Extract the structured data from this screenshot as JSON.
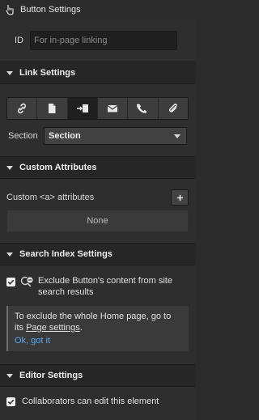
{
  "header": {
    "title": "Button Settings",
    "icon": "hand-pointer-icon"
  },
  "id_field": {
    "label": "ID",
    "placeholder": "For in-page linking",
    "value": ""
  },
  "sections": {
    "link": "Link Settings",
    "custom_attrs": "Custom Attributes",
    "search_index": "Search Index Settings",
    "editor": "Editor Settings"
  },
  "link_settings": {
    "tabs": [
      {
        "name": "url-link-icon",
        "active": false
      },
      {
        "name": "page-icon",
        "active": false
      },
      {
        "name": "section-anchor-icon",
        "active": true
      },
      {
        "name": "email-icon",
        "active": false
      },
      {
        "name": "phone-icon",
        "active": false
      },
      {
        "name": "attachment-icon",
        "active": false
      }
    ],
    "section_label": "Section",
    "section_value": "Section"
  },
  "custom_attributes": {
    "label": "Custom <a> attributes",
    "add_icon": "plus-icon",
    "empty_text": "None"
  },
  "search_index": {
    "checkbox_checked": true,
    "exclude_text": "Exclude Button's content from site search results",
    "info_prefix": "To exclude the whole Home page, go to its ",
    "info_link": "Page settings",
    "info_suffix": ".",
    "ok_text": "Ok, got it"
  },
  "editor_settings": {
    "checkbox_checked": true,
    "collab_text": "Collaborators can edit this element"
  },
  "colors": {
    "accent_link": "#5aa9f5",
    "panel_bg": "#2e2e2e",
    "header_bg": "#262626"
  }
}
